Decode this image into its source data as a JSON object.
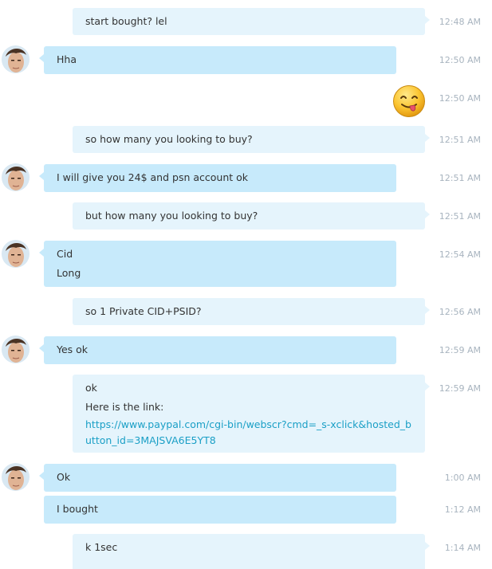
{
  "messages": [
    {
      "direction": "out",
      "lines": [
        "start bought? lel"
      ],
      "time": "12:48 AM"
    },
    {
      "direction": "in",
      "lines": [
        "Hha"
      ],
      "time": "12:50 AM"
    },
    {
      "direction": "out",
      "emoji": "tongue-out-smiley-icon",
      "time": "12:50 AM"
    },
    {
      "direction": "out",
      "lines": [
        "so how many you looking to buy?"
      ],
      "time": "12:51 AM"
    },
    {
      "direction": "in",
      "lines": [
        "I will give you 24$ and psn account ok"
      ],
      "time": "12:51 AM"
    },
    {
      "direction": "out",
      "lines": [
        "but how many you looking to buy?"
      ],
      "time": "12:51 AM"
    },
    {
      "direction": "in",
      "lines": [
        "Cid",
        "Long"
      ],
      "time": "12:54 AM"
    },
    {
      "direction": "out",
      "lines": [
        "so 1 Private CID+PSID?"
      ],
      "time": "12:56 AM"
    },
    {
      "direction": "in",
      "lines": [
        "Yes ok"
      ],
      "time": "12:59 AM"
    },
    {
      "direction": "out",
      "lines": [
        "ok",
        "Here is the link:"
      ],
      "link": "https://www.paypal.com/cgi-bin/webscr?cmd=_s-xclick&hosted_button_id=3MAJSVA6E5YT8",
      "time": "12:59 AM"
    },
    {
      "direction": "in",
      "lines": [
        "Ok"
      ],
      "time": "1:00 AM"
    },
    {
      "direction": "in",
      "lines": [
        "I bought"
      ],
      "time": "1:12 AM"
    },
    {
      "direction": "out",
      "lines": [
        "k 1sec"
      ],
      "time": "1:14 AM"
    }
  ],
  "colors": {
    "outgoing_bubble": "#e5f4fc",
    "incoming_bubble": "#c7eafb",
    "link": "#1a9fc6",
    "timestamp": "#a8b4bf"
  }
}
